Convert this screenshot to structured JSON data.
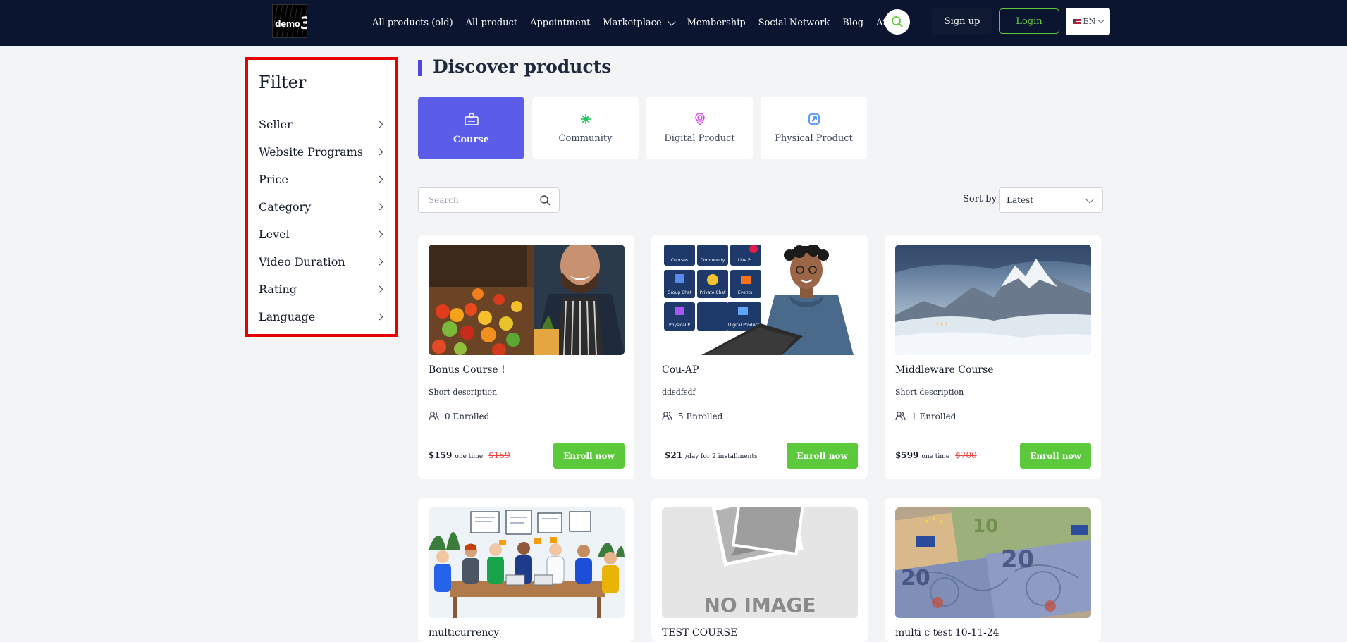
{
  "header": {
    "logo_text": "demo",
    "logo_number": "3",
    "nav": [
      "All products (old)",
      "All product",
      "Appointment",
      "Marketplace",
      "Membership",
      "Social Network",
      "Blog",
      "Affiliate user sign"
    ],
    "signup_label": "Sign up",
    "login_label": "Login",
    "language": "EN"
  },
  "filter": {
    "title": "Filter",
    "items": [
      "Seller",
      "Website Programs",
      "Price",
      "Category",
      "Level",
      "Video Duration",
      "Rating",
      "Language"
    ]
  },
  "main": {
    "title": "Discover products",
    "categories": [
      {
        "label": "Course",
        "icon": "course-icon",
        "active": true
      },
      {
        "label": "Community",
        "icon": "community-icon",
        "active": false
      },
      {
        "label": "Digital Product",
        "icon": "digital-product-icon",
        "active": false
      },
      {
        "label": "Physical Product",
        "icon": "physical-product-icon",
        "active": false
      }
    ],
    "search_placeholder": "Search",
    "sort_label": "Sort by",
    "sort_value": "Latest",
    "enroll_label": "Enroll now",
    "courses": [
      {
        "title": "Bonus Course !",
        "desc": "Short description",
        "enrolled": "0 Enrolled",
        "price": "$159",
        "price_note": "one time",
        "old_price": "$159",
        "image": "grocer"
      },
      {
        "title": "Cou-AP",
        "desc": "ddsdfsdf",
        "enrolled": "5 Enrolled",
        "price": "$21",
        "price_note": "/day for 2 installments",
        "old_price": "",
        "image": "laptop-man"
      },
      {
        "title": "Middleware Course",
        "desc": "Short description",
        "enrolled": "1 Enrolled",
        "price": "$599",
        "price_note": "one time",
        "old_price": "$700",
        "image": "mountain"
      },
      {
        "title": "multicurrency",
        "image": "team-meeting"
      },
      {
        "title": "TEST COURSE",
        "image": "no-image"
      },
      {
        "title": "multi c test 10-11-24",
        "image": "euro-banknotes"
      }
    ],
    "thumbnail_labels": {
      "courses": "Courses",
      "community": "Community",
      "live": "Live Pr",
      "group_chat": "Group Chat",
      "private_chat": "Private Chat",
      "events": "Events",
      "physical": "Physical P",
      "digital": "Digital Product",
      "no_image": "NO IMAGE",
      "note_10": "10",
      "note_20": "20"
    }
  },
  "colors": {
    "header_bg": "#0b1530",
    "accent": "#5b5ce8",
    "green": "#5cc93c",
    "highlight_border": "#e60000",
    "old_price": "#ef4444"
  }
}
